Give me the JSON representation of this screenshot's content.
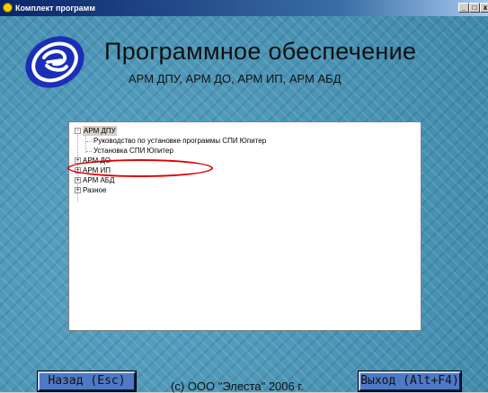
{
  "window": {
    "title": "Комплект программ",
    "minimize": "_",
    "maximize": "□",
    "close": "x"
  },
  "header": {
    "title": "Программное обеспечение",
    "subtitle": "АРМ ДПУ, АРМ ДО, АРМ ИП, АРМ АБД"
  },
  "tree": {
    "root_expanded": "АРМ ДПУ",
    "children": [
      "Руководство по установке программы СПИ Юпитер",
      "Установка СПИ Юпитер"
    ],
    "collapsed": [
      "АРМ ДО",
      "АРМ ИП",
      "АРМ АБД",
      "Разное"
    ],
    "minus_sign": "-",
    "plus_sign": "+"
  },
  "footer": {
    "back_label": "Назад (Esc)",
    "exit_label": "Выход (Alt+F4)",
    "copyright": "(c) ООО \"Элеста\" 2006 г."
  },
  "colors": {
    "background": "#4a93b4",
    "button": "#4e79c4",
    "highlight": "#e00000"
  }
}
